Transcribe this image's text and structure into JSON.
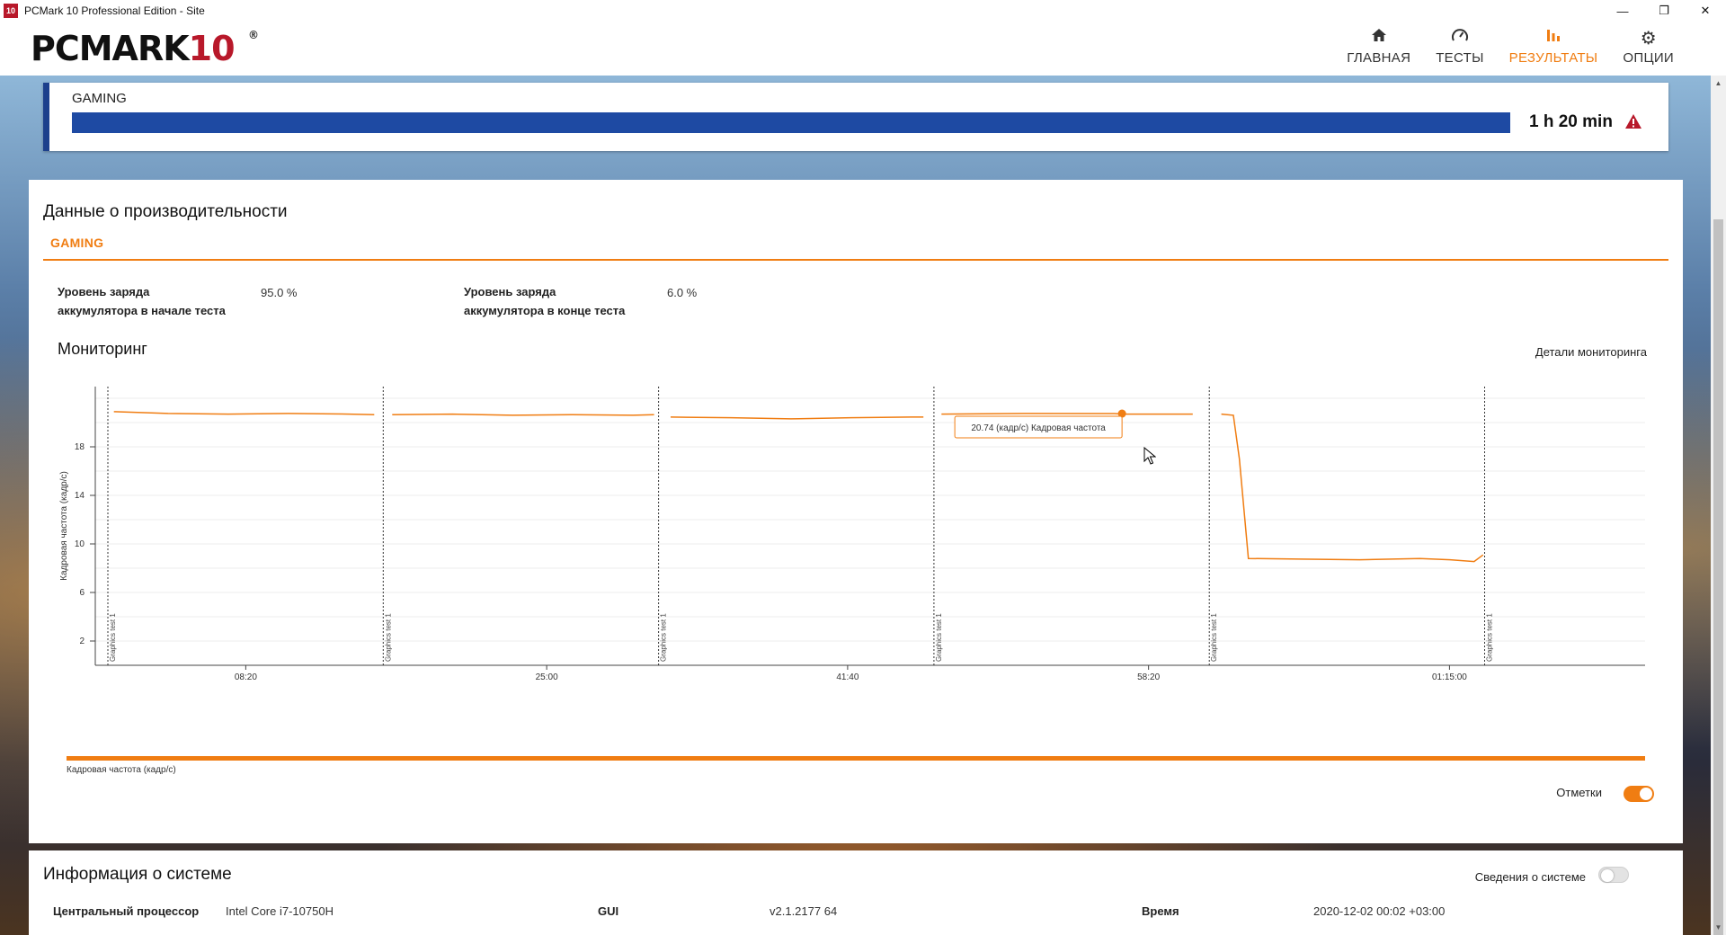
{
  "window": {
    "title": "PCMark 10 Professional Edition - Site",
    "icon_text": "10",
    "controls": [
      "minimize",
      "restore",
      "close"
    ]
  },
  "logo": {
    "main": "PCMARK",
    "number": "10",
    "reg": "®"
  },
  "nav": [
    {
      "label": "ГЛАВНАЯ",
      "icon": "home-icon",
      "active": false
    },
    {
      "label": "ТЕСТЫ",
      "icon": "gauge-icon",
      "active": false
    },
    {
      "label": "РЕЗУЛЬТАТЫ",
      "icon": "bar-chart-icon",
      "active": true
    },
    {
      "label": "ОПЦИИ",
      "icon": "gear-icon",
      "active": false
    }
  ],
  "gaming_summary": {
    "label": "GAMING",
    "duration": "1 h 20 min",
    "warning_icon": "warning-icon",
    "bar_color": "#1e4aa3"
  },
  "performance": {
    "title": "Данные о производительности",
    "tab": "GAMING",
    "battery_start_label_1": "Уровень заряда",
    "battery_start_label_2": "аккумулятора в начале теста",
    "battery_start_value": "95.0 %",
    "battery_end_label_1": "Уровень заряда",
    "battery_end_label_2": "аккумулятора в конце теста",
    "battery_end_value": "6.0 %"
  },
  "monitoring": {
    "title": "Мониторинг",
    "details_link": "Детали мониторинга",
    "tooltip": "20.74 (кадр/с) Кадровая частота",
    "legend": "Кадровая частота (кадр/с)",
    "marks_label": "Отметки",
    "marks_on": true
  },
  "chart_data": {
    "type": "line",
    "ylabel": "Кадровая частота (кадр/с)",
    "y_ticks": [
      "2",
      "6",
      "10",
      "14",
      "18"
    ],
    "ylim": [
      0,
      23
    ],
    "x_ticks": [
      "08:20",
      "25:00",
      "41:40",
      "58:20",
      "01:15:00"
    ],
    "x_tick_seconds": [
      500,
      1500,
      2500,
      3500,
      4500
    ],
    "xlim_seconds": [
      0,
      5150
    ],
    "markers": [
      {
        "label": "Graphics test 1",
        "t": 0
      },
      {
        "label": "Graphics test 1",
        "t": 915
      },
      {
        "label": "Graphics test 1",
        "t": 1830
      },
      {
        "label": "Graphics test 1",
        "t": 2745
      },
      {
        "label": "Graphics test 1",
        "t": 3660
      },
      {
        "label": "Graphics test 1",
        "t": 4575
      }
    ],
    "series": [
      {
        "name": "Кадровая частота (кадр/с)",
        "color": "#f07d12",
        "segments": [
          {
            "x": [
              20,
              200,
              400,
              600,
              800,
              885
            ],
            "y": [
              20.9,
              20.75,
              20.7,
              20.75,
              20.7,
              20.65
            ]
          },
          {
            "x": [
              30,
              230,
              430,
              630,
              830,
              900
            ],
            "y": [
              20.65,
              20.7,
              20.6,
              20.65,
              20.6,
              20.65
            ]
          },
          {
            "x": [
              40,
              240,
              440,
              640,
              840,
              880
            ],
            "y": [
              20.45,
              20.4,
              20.3,
              20.4,
              20.45,
              20.45
            ]
          },
          {
            "x": [
              25,
              300,
              600,
              625,
              860
            ],
            "y": [
              20.7,
              20.75,
              20.74,
              20.7,
              20.7
            ]
          },
          {
            "x": [
              40,
              80,
              100,
              130,
              300,
              500,
              700,
              800,
              880,
              910
            ],
            "y": [
              20.7,
              20.6,
              17,
              8.8,
              8.75,
              8.7,
              8.8,
              8.7,
              8.55,
              9.1
            ]
          }
        ]
      }
    ],
    "highlight_point": {
      "segment": 3,
      "x": 625,
      "y": 20.74
    }
  },
  "system_info": {
    "title": "Информация о системе",
    "toggle_label": "Сведения о системе",
    "toggle_on": false,
    "cpu_label": "Центральный процессор",
    "cpu_value": "Intel Core i7-10750H",
    "gui_label": "GUI",
    "gui_value": "v2.1.2177 64",
    "time_label": "Время",
    "time_value": "2020-12-02 00:02 +03:00"
  }
}
